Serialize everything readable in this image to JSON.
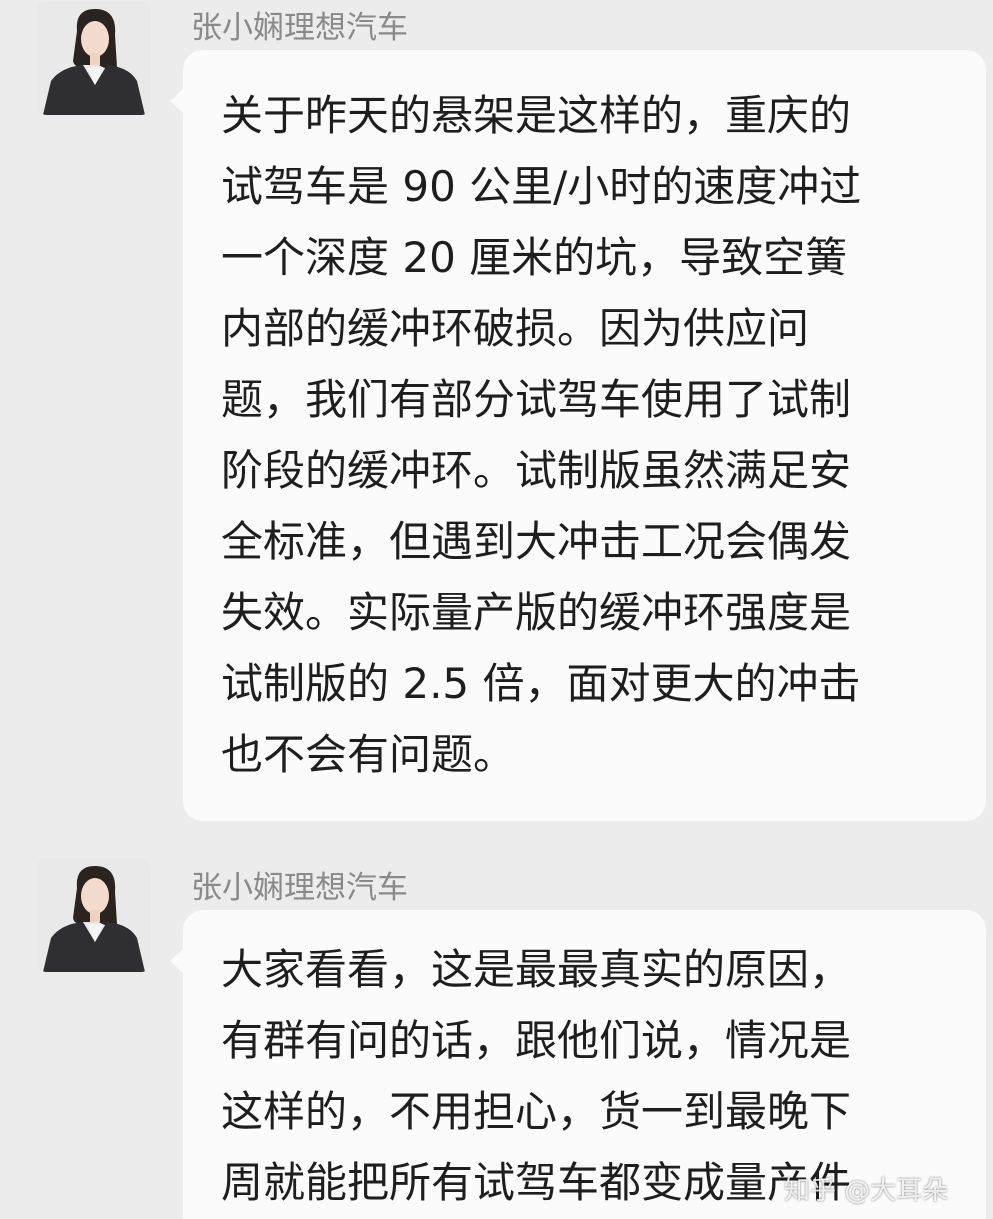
{
  "messages": [
    {
      "sender": "张小娴理想汽车",
      "lines": [
        "关于昨天的悬架是这样的，重庆的",
        "试驾车是 90 公里/小时的速度冲过",
        "一个深度 20 厘米的坑，导致空簧",
        "内部的缓冲环破损。因为供应问",
        "题，我们有部分试驾车使用了试制",
        "阶段的缓冲环。试制版虽然满足安",
        "全标准，但遇到大冲击工况会偶发",
        "失效。实际量产版的缓冲环强度是",
        "试制版的 2.5 倍，面对更大的冲击",
        "也不会有问题。"
      ]
    },
    {
      "sender": "张小娴理想汽车",
      "lines": [
        "大家看看，这是最最真实的原因，",
        "有群有问的话，跟他们说，情况是",
        "这样的，不用担心，货一到最晚下",
        "周就能把所有试驾车都变成量产件"
      ]
    }
  ],
  "watermark": "知乎 @大耳朵",
  "colors": {
    "background": "#ececec",
    "bubble": "#fbfbfb",
    "sender_text": "#8a8a8a",
    "message_text": "#1e1e1e"
  },
  "icons": {
    "avatar": "person-photo-icon"
  }
}
